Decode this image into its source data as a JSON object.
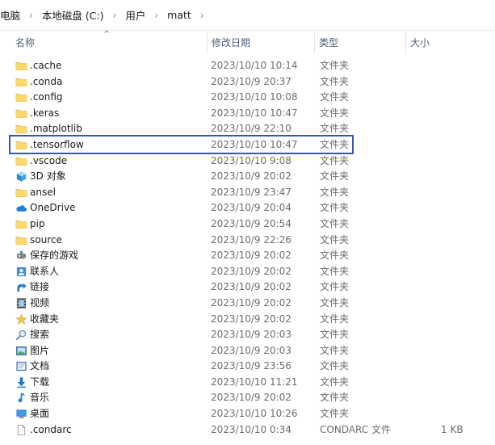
{
  "breadcrumb": [
    "电脑",
    "本地磁盘 (C:)",
    "用户",
    "matt"
  ],
  "columns": {
    "name": "名称",
    "date": "修改日期",
    "type": "类型",
    "size": "大小"
  },
  "sort_indicator": "^",
  "colors": {
    "folder": "#f8d775",
    "folder_dark": "#e8b74a",
    "highlight": "#3555b5",
    "header_text": "#4c607a"
  },
  "rows": [
    {
      "name": ".cache",
      "date": "2023/10/10 10:14",
      "type": "文件夹",
      "size": "",
      "icon": "folder-icon"
    },
    {
      "name": ".conda",
      "date": "2023/10/9 20:37",
      "type": "文件夹",
      "size": "",
      "icon": "folder-icon"
    },
    {
      "name": ".config",
      "date": "2023/10/10 10:08",
      "type": "文件夹",
      "size": "",
      "icon": "folder-icon"
    },
    {
      "name": ".keras",
      "date": "2023/10/10 10:47",
      "type": "文件夹",
      "size": "",
      "icon": "folder-icon"
    },
    {
      "name": ".matplotlib",
      "date": "2023/10/9 22:10",
      "type": "文件夹",
      "size": "",
      "icon": "folder-icon"
    },
    {
      "name": ".tensorflow",
      "date": "2023/10/10 10:47",
      "type": "文件夹",
      "size": "",
      "icon": "folder-icon",
      "highlighted": true
    },
    {
      "name": ".vscode",
      "date": "2023/10/10 9:08",
      "type": "文件夹",
      "size": "",
      "icon": "folder-icon"
    },
    {
      "name": "3D 对象",
      "date": "2023/10/9 20:02",
      "type": "文件夹",
      "size": "",
      "icon": "3d-objects-icon"
    },
    {
      "name": "ansel",
      "date": "2023/10/9 23:47",
      "type": "文件夹",
      "size": "",
      "icon": "folder-icon"
    },
    {
      "name": "OneDrive",
      "date": "2023/10/9 20:04",
      "type": "文件夹",
      "size": "",
      "icon": "onedrive-icon"
    },
    {
      "name": "pip",
      "date": "2023/10/9 20:54",
      "type": "文件夹",
      "size": "",
      "icon": "folder-icon"
    },
    {
      "name": "source",
      "date": "2023/10/9 22:26",
      "type": "文件夹",
      "size": "",
      "icon": "folder-icon"
    },
    {
      "name": "保存的游戏",
      "date": "2023/10/9 20:02",
      "type": "文件夹",
      "size": "",
      "icon": "saved-games-icon"
    },
    {
      "name": "联系人",
      "date": "2023/10/9 20:02",
      "type": "文件夹",
      "size": "",
      "icon": "contacts-icon"
    },
    {
      "name": "链接",
      "date": "2023/10/9 20:02",
      "type": "文件夹",
      "size": "",
      "icon": "links-icon"
    },
    {
      "name": "视频",
      "date": "2023/10/9 20:02",
      "type": "文件夹",
      "size": "",
      "icon": "videos-icon"
    },
    {
      "name": "收藏夹",
      "date": "2023/10/9 20:02",
      "type": "文件夹",
      "size": "",
      "icon": "favorites-icon"
    },
    {
      "name": "搜索",
      "date": "2023/10/9 20:03",
      "type": "文件夹",
      "size": "",
      "icon": "searches-icon"
    },
    {
      "name": "图片",
      "date": "2023/10/9 20:03",
      "type": "文件夹",
      "size": "",
      "icon": "pictures-icon"
    },
    {
      "name": "文档",
      "date": "2023/10/9 23:56",
      "type": "文件夹",
      "size": "",
      "icon": "documents-icon"
    },
    {
      "name": "下载",
      "date": "2023/10/10 11:21",
      "type": "文件夹",
      "size": "",
      "icon": "downloads-icon"
    },
    {
      "name": "音乐",
      "date": "2023/10/9 20:02",
      "type": "文件夹",
      "size": "",
      "icon": "music-icon"
    },
    {
      "name": "桌面",
      "date": "2023/10/10 10:26",
      "type": "文件夹",
      "size": "",
      "icon": "desktop-icon"
    },
    {
      "name": ".condarc",
      "date": "2023/10/10 0:34",
      "type": "CONDARC 文件",
      "size": "1 KB",
      "icon": "file-icon"
    }
  ]
}
